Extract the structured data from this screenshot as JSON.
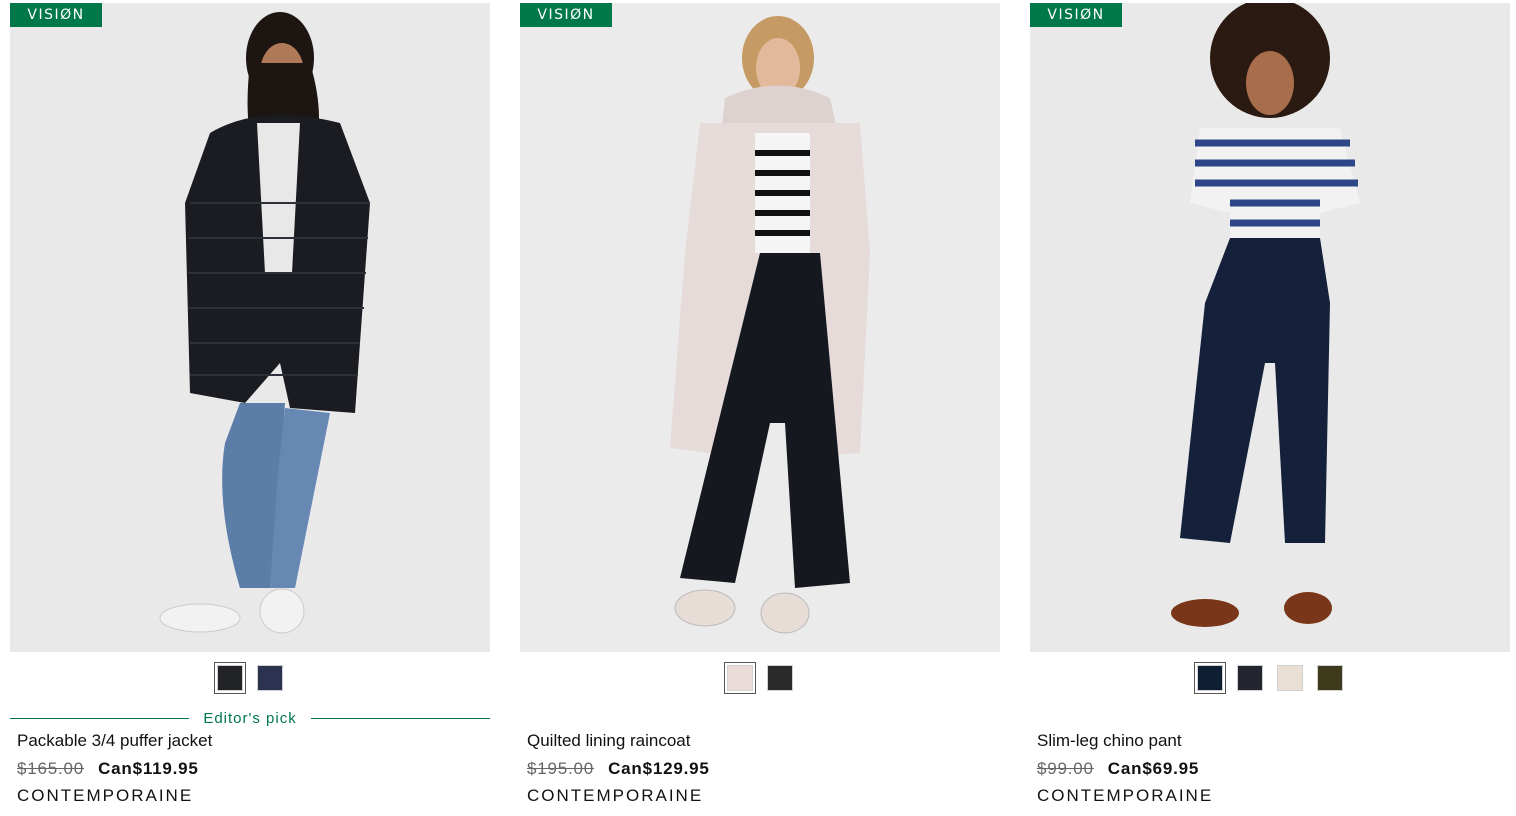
{
  "products": [
    {
      "badge": "VISIØN",
      "image_desc": "puffer",
      "swatches": [
        {
          "color": "#222326",
          "selected": true
        },
        {
          "color": "#2b3350",
          "selected": false
        }
      ],
      "editors_pick": "Editor's pick",
      "name": "Packable 3/4 puffer jacket",
      "old_price": "$165.00",
      "new_price": "Can$119.95",
      "brand": "CONTEMPORAINE"
    },
    {
      "badge": "VISIØN",
      "image_desc": "raincoat",
      "swatches": [
        {
          "color": "#e9dcd9",
          "selected": true
        },
        {
          "color": "#2a2a2a",
          "selected": false
        }
      ],
      "editors_pick": "",
      "name": "Quilted lining raincoat",
      "old_price": "$195.00",
      "new_price": "Can$129.95",
      "brand": "CONTEMPORAINE"
    },
    {
      "badge": "VISIØN",
      "image_desc": "chino",
      "swatches": [
        {
          "color": "#0f1e33",
          "selected": true
        },
        {
          "color": "#23262e",
          "selected": false
        },
        {
          "color": "#e9dfd4",
          "selected": false
        },
        {
          "color": "#3d3b1c",
          "selected": false
        }
      ],
      "editors_pick": "",
      "name": "Slim-leg chino pant",
      "old_price": "$99.00",
      "new_price": "Can$69.95",
      "brand": "CONTEMPORAINE"
    }
  ],
  "colors": {
    "accent_green": "#00784a",
    "photo_bg": "#e8e8e8"
  }
}
